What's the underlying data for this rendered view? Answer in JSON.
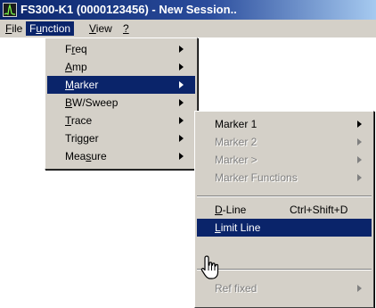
{
  "window": {
    "title": "FS300-K1 (0000123456) - New Session.."
  },
  "menubar": {
    "items": [
      {
        "label": "File",
        "u": "F",
        "rest": "ile"
      },
      {
        "label": "Function",
        "pre": "F",
        "u": "u",
        "rest": "nction"
      },
      {
        "label": "View",
        "u": "V",
        "rest": "iew"
      },
      {
        "label": "?",
        "u": "?",
        "rest": ""
      }
    ]
  },
  "function_menu": {
    "items": [
      {
        "pre": "F",
        "u": "r",
        "rest": "eq"
      },
      {
        "pre": "",
        "u": "A",
        "rest": "mp"
      },
      {
        "pre": "",
        "u": "M",
        "rest": "arker"
      },
      {
        "pre": "",
        "u": "B",
        "rest": "W/Sweep"
      },
      {
        "pre": "",
        "u": "T",
        "rest": "race"
      },
      {
        "pre": "Tri",
        "u": "g",
        "rest": "ger"
      },
      {
        "pre": "Mea",
        "u": "s",
        "rest": "ure"
      }
    ]
  },
  "marker_menu": {
    "items": [
      {
        "label": "Marker 1"
      },
      {
        "label": "Marker 2"
      },
      {
        "label": "Marker >"
      },
      {
        "label": "Marker Functions"
      },
      {
        "pre": "",
        "u": "D",
        "rest": "-Line",
        "shortcut": "Ctrl+Shift+D"
      },
      {
        "pre": "",
        "u": "L",
        "rest": "imit Line"
      },
      {
        "label": "Ref fixed"
      }
    ]
  }
}
